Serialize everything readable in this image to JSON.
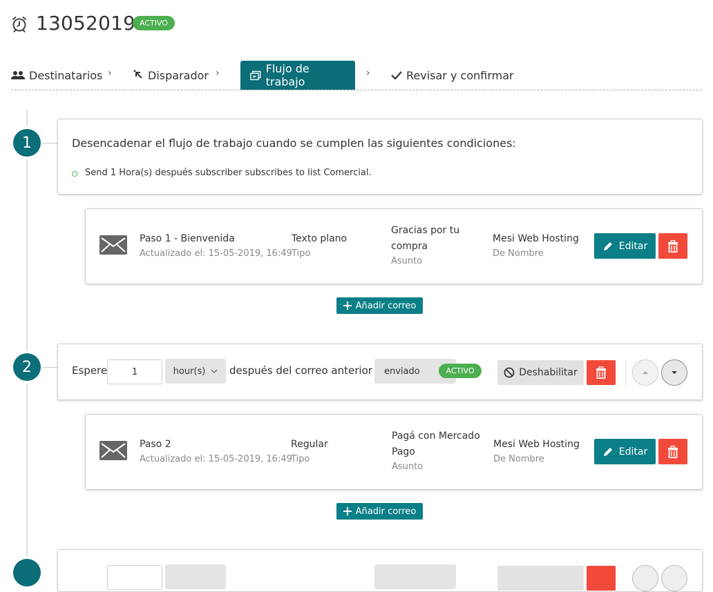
{
  "header": {
    "title": "13052019",
    "status_badge": "ACTIVO"
  },
  "tabs": [
    {
      "label": "Destinatarios",
      "icon": "users-icon"
    },
    {
      "label": "Disparador",
      "icon": "cursor-icon"
    },
    {
      "label": "Flujo de trabajo",
      "icon": "workflow-icon",
      "active": true
    },
    {
      "label": "Revisar y confirmar",
      "icon": "check-icon"
    }
  ],
  "tab_separator": "›",
  "trigger": {
    "step_number": "1",
    "heading": "Desencadenar el flujo de trabajo cuando se cumplen las siguientes condiciones:",
    "condition": "Send 1 Hora(s) después subscriber subscribes to list Comercial."
  },
  "emails": [
    {
      "title": "Paso 1 - Bienvenida",
      "updated": "Actualizado el: 15-05-2019, 16:49",
      "type_value": "Texto plano",
      "type_label": "Tipo",
      "subject_line1": "Gracias por tu",
      "subject_line2": "compra",
      "subject_label": "Asunto",
      "from_value": "Mesi Web Hosting",
      "from_label": "De Nombre",
      "edit_label": "Editar"
    },
    {
      "title": "Paso 2",
      "updated": "Actualizado el: 15-05-2019, 16:49",
      "type_value": "Regular",
      "type_label": "Tipo",
      "subject_line1": "Pagá con Mercado",
      "subject_line2": "Pago",
      "subject_label": "Asunto",
      "from_value": "Mesi Web Hosting",
      "from_label": "De Nombre",
      "edit_label": "Editar"
    }
  ],
  "add_email_label": "Añadir correo",
  "wait": {
    "step_number": "2",
    "label_before": "Espere",
    "amount": "1",
    "unit": "hour(s)",
    "label_after": "después del correo anterior es",
    "condition": "enviado",
    "status_badge": "ACTIVO",
    "disable_label": "Deshabilitar"
  },
  "colors": {
    "teal": "#0b6e78",
    "button_teal": "#0b7f87",
    "green": "#4caf50",
    "red": "#f24a3a"
  }
}
